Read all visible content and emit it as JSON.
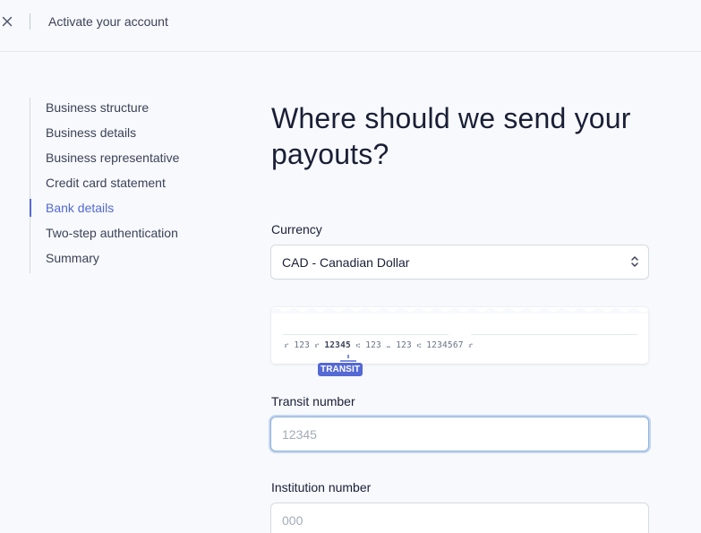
{
  "topbar": {
    "title": "Activate your account"
  },
  "steps": [
    {
      "label": "Business structure",
      "active": false
    },
    {
      "label": "Business details",
      "active": false
    },
    {
      "label": "Business representative",
      "active": false
    },
    {
      "label": "Credit card statement",
      "active": false
    },
    {
      "label": "Bank details",
      "active": true
    },
    {
      "label": "Two-step authentication",
      "active": false
    },
    {
      "label": "Summary",
      "active": false
    }
  ],
  "main": {
    "heading": "Where should we send your payouts?",
    "currency": {
      "label": "Currency",
      "value": "CAD - Canadian Dollar"
    },
    "cheque": {
      "micr_parts": [
        "123",
        "12345",
        "123",
        "123",
        "1234567"
      ],
      "badge": "TRANSIT"
    },
    "transit": {
      "label": "Transit number",
      "placeholder": "12345"
    },
    "institution": {
      "label": "Institution number",
      "placeholder": "000"
    }
  },
  "colors": {
    "accent": "#5469d4",
    "text": "#1a1f36",
    "muted": "#3c4257",
    "background": "#f7f9fc",
    "border": "#d5dbe1"
  },
  "icons": {
    "close": "close-icon",
    "select": "chevron-up-down-icon"
  }
}
